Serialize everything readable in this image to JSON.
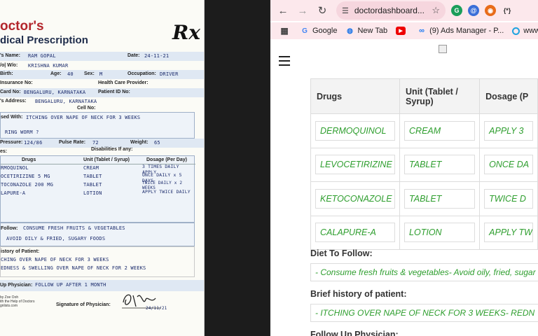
{
  "prescription": {
    "title_line1": "octor's",
    "title_line2": "dical Prescription",
    "rx_symbol": "Rx",
    "fields": {
      "name_label": "'s Name:",
      "name_value": "RAM GOPAL",
      "date_label": "Date:",
      "date_value": "24-11-21",
      "relation_label": "/o| W/o:",
      "relation_value": "KRISHNA KUMAR",
      "dob_label": "Birth:",
      "age_label": "Age:",
      "age_value": "40",
      "sex_label": "Sex:",
      "sex_value": "M",
      "occupation_label": "Occupation:",
      "occupation_value": "DRIVER",
      "insurance_label": "Insurance No:",
      "provider_label": "Health Care Provider:",
      "card_label": "Card No:",
      "card_value": "BENGALURU, KARNATAKA",
      "patient_id_label": "Patient ID No:",
      "address_label": "'s Address:",
      "address_value": "BENGALURU, KARNATAKA",
      "cell_label": "Cell No:",
      "diagnosed_label": "sed With:",
      "diagnosed_value": "ITCHING OVER NAPE OF NECK FOR 3 WEEKS",
      "diagnosed_value2": "RING WORM ?",
      "pressure_label": "Pressure:",
      "pressure_value": "124/86",
      "pulse_label": "Pulse Rate:",
      "pulse_value": "72",
      "weight_label": "Weight:",
      "weight_value": "65",
      "disabilities_label": "Disabilities If any:",
      "allergies_label": "es:"
    },
    "table_headers": [
      "Drugs",
      "Unit (Tablet / Syrup)",
      "Dosage (Per Day)"
    ],
    "table_rows": [
      [
        "RMOQUINOL",
        "CREAM",
        "3 TIMES DAILY APPLY"
      ],
      [
        "OCETIRIZINE 5 MG",
        "TABLET",
        "ONCE DAILY x 5 DAYS"
      ],
      [
        "TOCONAZOLE 200 MG",
        "TABLET",
        "TWICE DAILY x 2 WEEKS"
      ],
      [
        "LAPURE-A",
        "LOTION",
        "APPLY TWICE DAILY"
      ]
    ],
    "diet_label": "Follow:",
    "diet_line1": "CONSUME FRESH FRUITS & VEGETABLES",
    "diet_line2": "AVOID OILY & FRIED, SUGARY FOODS",
    "history_label": "istory of Patient:",
    "history_line1": "CHING OVER NAPE OF NECK FOR 3 WEEKS",
    "history_line2": "EDNESS & SWELLING OVER NAPE OF NECK FOR 2 WEEKS",
    "followup_label": "Up Physician:",
    "followup_value": "FOLLOW UP AFTER 1 MONTH",
    "signature_label": "Signature of Physician:",
    "signature_date": "24/11/21",
    "footer_line1": "by Zoe Ooh",
    "footer_line2": "ith the Help of Doctors",
    "footer_line3": "gnlists.com"
  },
  "browser": {
    "address": "doctordashboard...",
    "bookmarks": [
      {
        "label": "Google",
        "icon": "google-g-icon"
      },
      {
        "label": "New Tab",
        "icon": "new-tab-icon"
      },
      {
        "label": "",
        "icon": "youtube-icon"
      },
      {
        "label": "(9) Ads Manager - P...",
        "icon": "meta-icon"
      },
      {
        "label": "www.al",
        "icon": "site-ring-icon"
      }
    ],
    "colors": {
      "accent_pink": "#fce8ec",
      "value_green": "#2e9e2e"
    }
  },
  "dashboard": {
    "table_headers": [
      "Drugs",
      "Unit (Tablet / Syrup)",
      "Dosage (P"
    ],
    "rows": [
      [
        "DERMOQUINOL",
        "CREAM",
        "APPLY 3"
      ],
      [
        "LEVOCETIRIZINE",
        "TABLET",
        "ONCE DA"
      ],
      [
        "KETOCONAZOLE",
        "TABLET",
        "TWICE D"
      ],
      [
        "CALAPURE-A",
        "LOTION",
        "APPLY TW"
      ]
    ],
    "diet_label": "Diet To Follow:",
    "diet_value": "- Consume fresh fruits & vegetables- Avoid oily, fried, sugar",
    "history_label": "Brief history of patient:",
    "history_value": "- ITCHING OVER NAPE OF NECK FOR 3 WEEKS- REDN",
    "followup_label": "Follow Up Physician:"
  }
}
